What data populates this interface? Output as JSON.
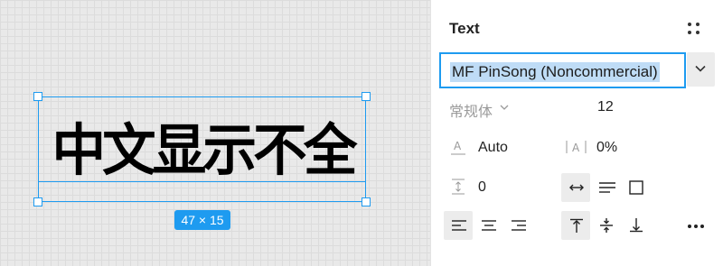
{
  "canvas": {
    "layer_text": "中文显示不全",
    "size_badge": "47 × 15"
  },
  "panel": {
    "title": "Text",
    "font_family": "MF PinSong (Noncommercial)",
    "font_weight": "常规体",
    "font_size": "12",
    "line_height": "Auto",
    "letter_spacing": "0%",
    "paragraph_spacing": "0"
  },
  "colors": {
    "selection": "#1e9bf0",
    "text_highlight": "#bfdcf6",
    "active_button": "#ececec"
  },
  "icons": [
    "grid-dots-icon",
    "chevron-down-icon",
    "line-height-icon",
    "letter-spacing-icon",
    "paragraph-spacing-icon",
    "auto-width-icon",
    "auto-height-icon",
    "fixed-size-icon",
    "align-left-icon",
    "align-center-icon",
    "align-right-icon",
    "align-top-icon",
    "align-middle-icon",
    "align-bottom-icon",
    "more-icon"
  ]
}
